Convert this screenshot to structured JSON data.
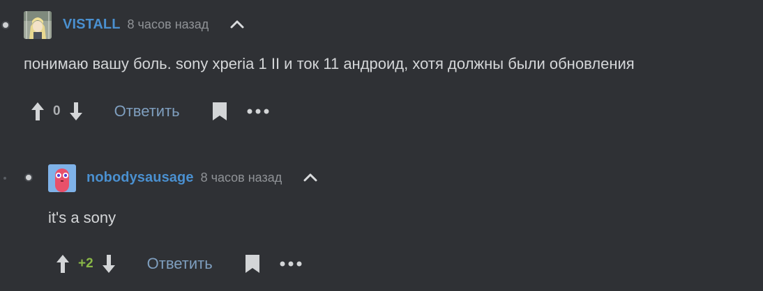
{
  "comments": [
    {
      "username": "VISTALL",
      "time": "8 часов назад",
      "text": "понимаю вашу боль. sony xperia 1 II и ток 11 андроид, хотя должны были обновления",
      "score": "0",
      "reply_label": "Ответить",
      "avatar_icon": "anime-character-avatar"
    },
    {
      "username": "nobodysausage",
      "time": "8 часов назад",
      "text": "it's a sony",
      "score": "+2",
      "reply_label": "Ответить",
      "avatar_icon": "pink-sausage-avatar"
    }
  ],
  "colors": {
    "background": "#2f3135",
    "username": "#4a90d0",
    "reply_link": "#7f9fbf",
    "positive_score": "#8ab847"
  }
}
